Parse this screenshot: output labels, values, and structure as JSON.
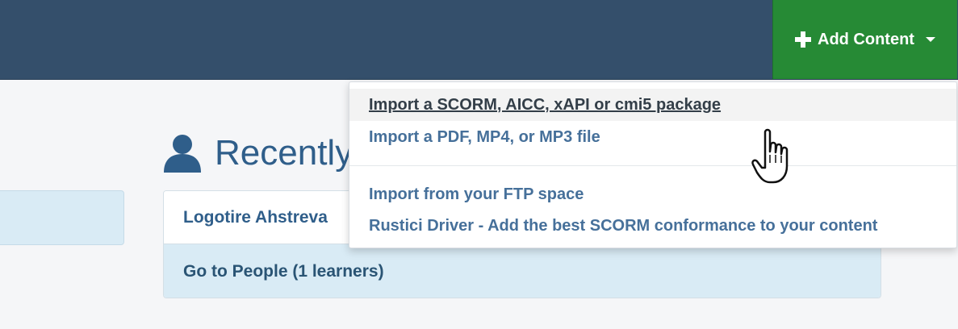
{
  "header": {
    "add_content_label": "Add Content",
    "plus_icon": "plus-icon",
    "caret_icon": "caret-down-icon",
    "colors": {
      "bar": "#344f6b",
      "button": "#268a35"
    }
  },
  "dashboard": {
    "recently_heading": "Recently",
    "person_icon": "user-icon",
    "card": {
      "learner_name": "Logotire Ahstreva",
      "people_link": "Go to People (1 learners)"
    }
  },
  "dropdown": {
    "items": [
      {
        "label": "Import a SCORM, AICC, xAPI or cmi5 package",
        "state": "hovered"
      },
      {
        "label": "Import a PDF, MP4, or MP3 file"
      },
      {
        "label": "Import from your FTP space"
      },
      {
        "label": "Rustici Driver - Add the best SCORM conformance to your content"
      }
    ]
  },
  "cursor": {
    "type": "hand-pointer-icon"
  }
}
